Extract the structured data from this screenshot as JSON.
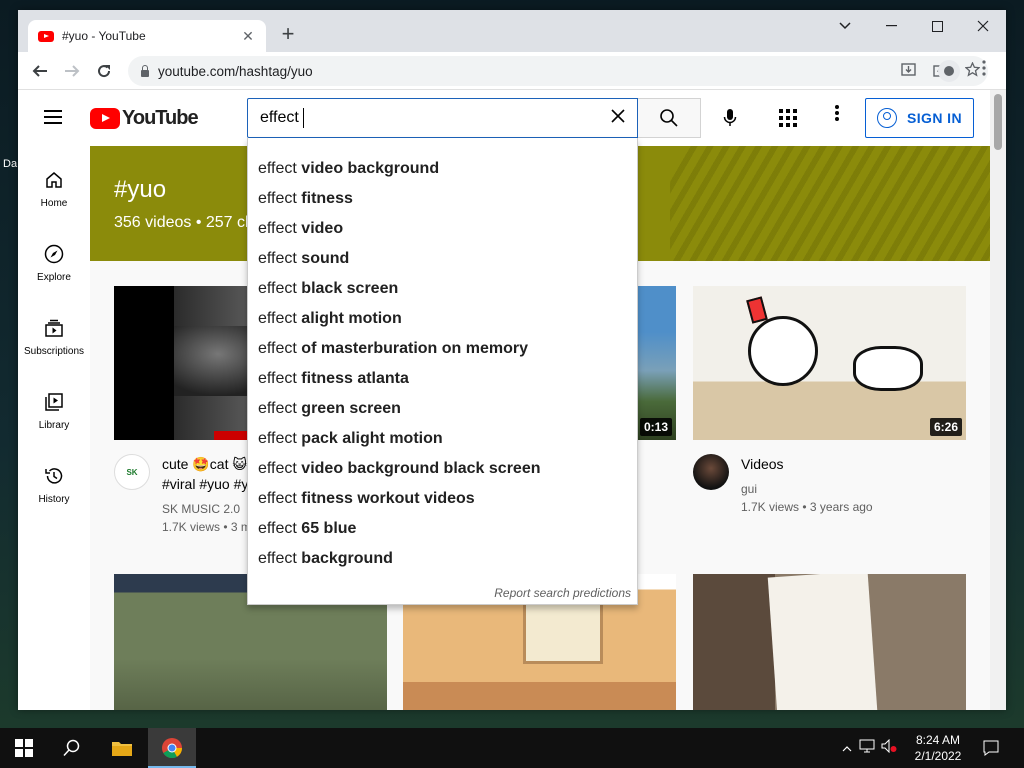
{
  "desktop": {
    "icon_text": "Da"
  },
  "browser": {
    "tab_title": "#yuo - YouTube",
    "url": "youtube.com/hashtag/yuo",
    "new_tab": "+",
    "tab_close": "✕"
  },
  "youtube": {
    "logo_text": "YouTube",
    "search_query": "effect",
    "sign_in": "SIGN IN",
    "guide": [
      {
        "label": "Home"
      },
      {
        "label": "Explore"
      },
      {
        "label": "Subscriptions"
      },
      {
        "label": "Library"
      },
      {
        "label": "History"
      }
    ],
    "hashtag": {
      "title": "#yuo",
      "stats": "356 videos • 257 cl"
    },
    "videos": [
      {
        "title_line1": "cute 🤩cat 😺",
        "title_line2": "#viral #yuo #y",
        "channel": "SK  MUSIC 2.0",
        "views": "1.7K views • 3 m",
        "duration": ""
      },
      {
        "duration": "0:13"
      },
      {
        "title_line1": "Videos",
        "channel": "gui",
        "views": "1.7K views • 3 years ago",
        "duration": "6:26"
      }
    ],
    "suggestions": [
      {
        "prefix": "effect ",
        "rest": "video background"
      },
      {
        "prefix": "effect ",
        "rest": "fitness"
      },
      {
        "prefix": "effect ",
        "rest": "video"
      },
      {
        "prefix": "effect ",
        "rest": "sound"
      },
      {
        "prefix": "effect ",
        "rest": "black screen"
      },
      {
        "prefix": "effect ",
        "rest": "alight motion"
      },
      {
        "prefix": "effect ",
        "rest": "of masterburation on memory"
      },
      {
        "prefix": "effect ",
        "rest": "fitness atlanta"
      },
      {
        "prefix": "effect ",
        "rest": "green screen"
      },
      {
        "prefix": "effect ",
        "rest": "pack alight motion"
      },
      {
        "prefix": "effect ",
        "rest": "video background black screen"
      },
      {
        "prefix": "effect ",
        "rest": "fitness workout videos"
      },
      {
        "prefix": "effect ",
        "rest": "65 blue"
      },
      {
        "prefix": "effect ",
        "rest": "background"
      }
    ],
    "report_text": "Report search predictions"
  },
  "taskbar": {
    "time": "8:24 AM",
    "date": "2/1/2022"
  },
  "colors": {
    "yt_red": "#ff0000",
    "banner": "#8b8b0b",
    "link_blue": "#065fd4"
  }
}
